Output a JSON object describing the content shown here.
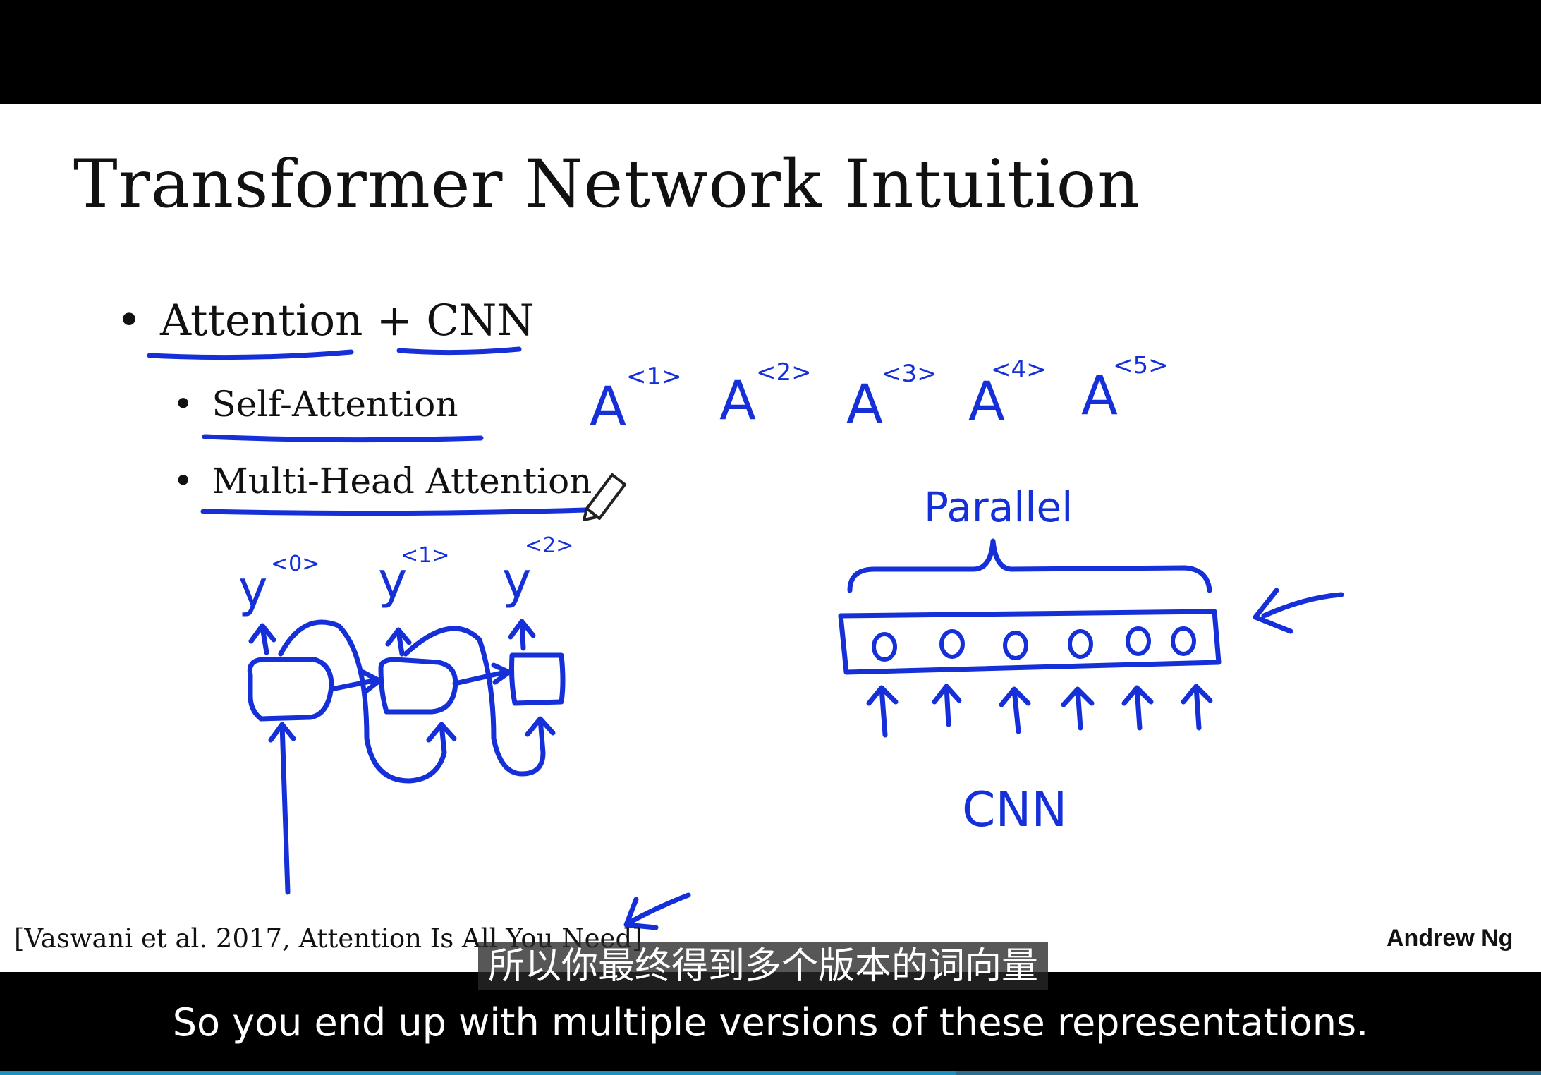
{
  "slide": {
    "title": "Transformer Network Intuition",
    "bullets": [
      {
        "marker": "•",
        "parts": [
          "Attention",
          " + ",
          "CNN"
        ]
      },
      {
        "marker": "•",
        "text": "Self-Attention"
      },
      {
        "marker": "•",
        "text": "Multi-Head Attention"
      }
    ],
    "citation": "[Vaswani et al. 2017, Attention Is All You Need]",
    "author": "Andrew Ng"
  },
  "annotations": {
    "attention_outputs": [
      "A",
      "A",
      "A",
      "A",
      "A"
    ],
    "attention_superscripts": [
      "<1>",
      "<2>",
      "<3>",
      "<4>",
      "<5>"
    ],
    "rnn_outputs": [
      "y",
      "y",
      "y"
    ],
    "rnn_superscripts": [
      "<0>",
      "<1>",
      "<2>"
    ],
    "parallel_label": "Parallel",
    "cnn_label": "CNN",
    "ink_color": "#1530d8"
  },
  "subtitles": {
    "zh": "所以你最终得到多个版本的词向量",
    "en": "So you end up with multiple versions of these representations."
  },
  "player": {
    "progress_fraction": 0.62,
    "progress_color": "#1e90c0",
    "watermark_icon": "tv-play-icon"
  }
}
